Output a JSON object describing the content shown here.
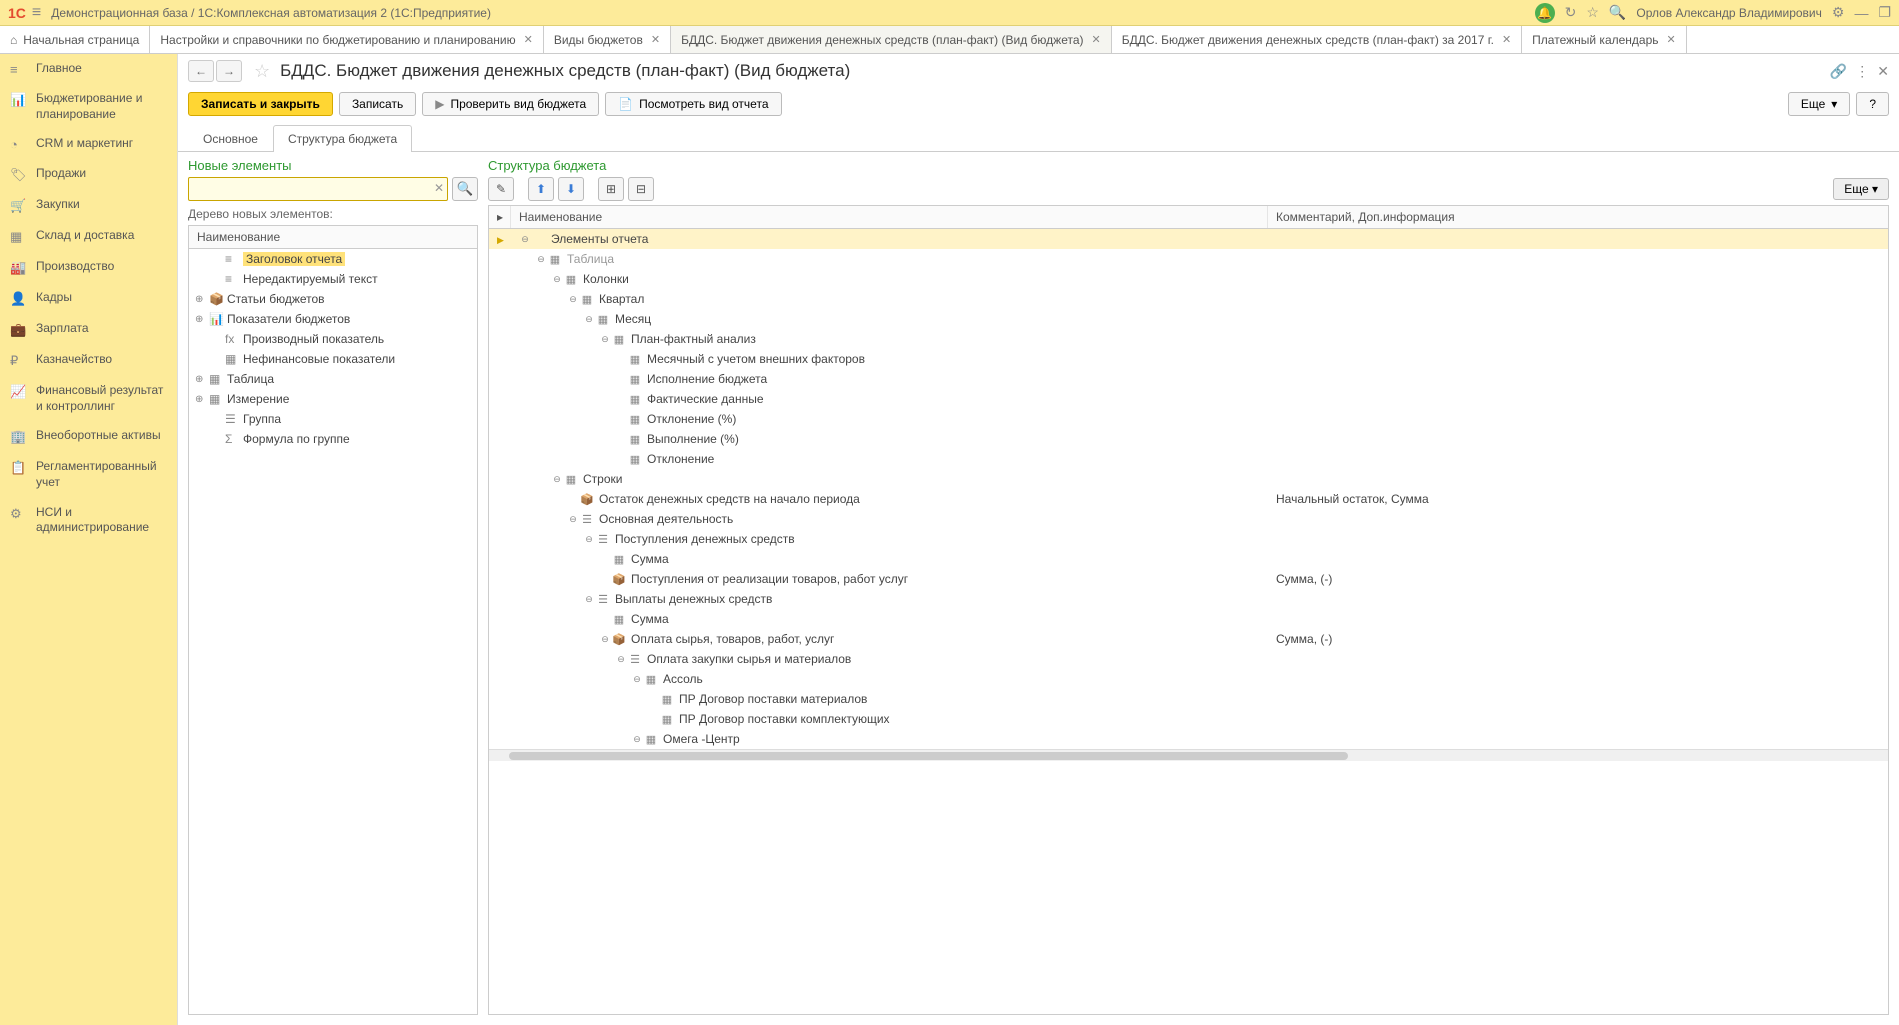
{
  "titlebar": {
    "logo": "1С",
    "title": "Демонстрационная база / 1С:Комплексная автоматизация 2 (1С:Предприятие)",
    "user": "Орлов Александр Владимирович"
  },
  "tabs": [
    {
      "label": "Начальная страница",
      "home": true
    },
    {
      "label": "Настройки и справочники по бюджетированию и планированию",
      "close": true
    },
    {
      "label": "Виды бюджетов",
      "close": true
    },
    {
      "label": "БДДС. Бюджет движения денежных средств (план-факт) (Вид бюджета)",
      "close": true,
      "active": true
    },
    {
      "label": "БДДС. Бюджет движения денежных средств (план-факт) за 2017 г.",
      "close": true
    },
    {
      "label": "Платежный календарь",
      "close": true
    }
  ],
  "sidebar": [
    {
      "icon": "≡",
      "label": "Главное"
    },
    {
      "icon": "📊",
      "label": "Бюджетирование и планирование"
    },
    {
      "icon": "◔",
      "label": "CRM и маркетинг"
    },
    {
      "icon": "🏷",
      "label": "Продажи"
    },
    {
      "icon": "🛒",
      "label": "Закупки"
    },
    {
      "icon": "▦",
      "label": "Склад и доставка"
    },
    {
      "icon": "🏭",
      "label": "Производство"
    },
    {
      "icon": "👤",
      "label": "Кадры"
    },
    {
      "icon": "💼",
      "label": "Зарплата"
    },
    {
      "icon": "₽",
      "label": "Казначейство"
    },
    {
      "icon": "📈",
      "label": "Финансовый результат и контроллинг"
    },
    {
      "icon": "🏢",
      "label": "Внеоборотные активы"
    },
    {
      "icon": "📋",
      "label": "Регламентированный учет"
    },
    {
      "icon": "⚙",
      "label": "НСИ и администрирование"
    }
  ],
  "page": {
    "title": "БДДС. Бюджет движения денежных средств (план-факт) (Вид бюджета)",
    "btn_save_close": "Записать и закрыть",
    "btn_save": "Записать",
    "btn_check": "Проверить вид бюджета",
    "btn_view": "Посмотреть вид отчета",
    "btn_more": "Еще",
    "btn_help": "?"
  },
  "innertabs": [
    {
      "label": "Основное"
    },
    {
      "label": "Структура бюджета",
      "active": true
    }
  ],
  "left": {
    "title": "Новые элементы",
    "tree_label": "Дерево новых элементов:",
    "col_name": "Наименование",
    "rows": [
      {
        "indent": 1,
        "exp": "",
        "icon": "≡",
        "label": "Заголовок отчета",
        "selected": true
      },
      {
        "indent": 1,
        "exp": "",
        "icon": "≡",
        "label": "Нередактируемый текст"
      },
      {
        "indent": 0,
        "exp": "⊕",
        "icon": "📦",
        "iconClass": "ic-grp",
        "label": "Статьи бюджетов"
      },
      {
        "indent": 0,
        "exp": "⊕",
        "icon": "📊",
        "iconClass": "ic-grp",
        "label": "Показатели бюджетов"
      },
      {
        "indent": 1,
        "exp": "",
        "icon": "fx",
        "iconClass": "ic-fx",
        "label": "Производный показатель"
      },
      {
        "indent": 1,
        "exp": "",
        "icon": "▦",
        "label": "Нефинансовые показатели"
      },
      {
        "indent": 0,
        "exp": "⊕",
        "icon": "▦",
        "iconClass": "ic-tbl",
        "label": "Таблица"
      },
      {
        "indent": 0,
        "exp": "⊕",
        "icon": "▦",
        "iconClass": "ic-tbl",
        "label": "Измерение"
      },
      {
        "indent": 1,
        "exp": "",
        "icon": "☰",
        "label": "Группа"
      },
      {
        "indent": 1,
        "exp": "",
        "icon": "Σ",
        "label": "Формула по группе"
      }
    ]
  },
  "right": {
    "title": "Структура бюджета",
    "btn_more": "Еще",
    "col_name": "Наименование",
    "col_comment": "Комментарий, Доп.информация",
    "rows": [
      {
        "indent": 0,
        "exp": "⊖",
        "icon": "",
        "label": "Элементы отчета",
        "selected": true,
        "comment": ""
      },
      {
        "indent": 1,
        "exp": "⊖",
        "icon": "▦",
        "iconClass": "ic-tbl",
        "label": "Таблица",
        "comment": "",
        "muted": true
      },
      {
        "indent": 2,
        "exp": "⊖",
        "icon": "▦",
        "iconClass": "ic-green",
        "label": "Колонки",
        "comment": ""
      },
      {
        "indent": 3,
        "exp": "⊖",
        "icon": "▦",
        "iconClass": "ic-tbl",
        "label": "Квартал",
        "comment": ""
      },
      {
        "indent": 4,
        "exp": "⊖",
        "icon": "▦",
        "iconClass": "ic-tbl",
        "label": "Месяц",
        "comment": ""
      },
      {
        "indent": 5,
        "exp": "⊖",
        "icon": "▦",
        "iconClass": "ic-tbl",
        "label": "План-фактный анализ",
        "comment": ""
      },
      {
        "indent": 6,
        "exp": "",
        "icon": "▦",
        "iconClass": "ic-tbl",
        "label": "Месячный с учетом внешних факторов",
        "comment": ""
      },
      {
        "indent": 6,
        "exp": "",
        "icon": "▦",
        "iconClass": "ic-tbl",
        "label": "Исполнение бюджета",
        "comment": ""
      },
      {
        "indent": 6,
        "exp": "",
        "icon": "▦",
        "iconClass": "ic-tbl",
        "label": "Фактические данные",
        "comment": ""
      },
      {
        "indent": 6,
        "exp": "",
        "icon": "▦",
        "iconClass": "ic-tbl",
        "label": "Отклонение (%)",
        "comment": ""
      },
      {
        "indent": 6,
        "exp": "",
        "icon": "▦",
        "iconClass": "ic-tbl",
        "label": "Выполнение (%)",
        "comment": ""
      },
      {
        "indent": 6,
        "exp": "",
        "icon": "▦",
        "iconClass": "ic-tbl",
        "label": "Отклонение",
        "comment": ""
      },
      {
        "indent": 2,
        "exp": "⊖",
        "icon": "▦",
        "iconClass": "ic-grp",
        "label": "Строки",
        "comment": ""
      },
      {
        "indent": 3,
        "exp": "",
        "icon": "📦",
        "iconClass": "ic-grp",
        "label": "Остаток денежных средств на начало периода",
        "comment": "Начальный остаток, Сумма"
      },
      {
        "indent": 3,
        "exp": "⊖",
        "icon": "☰",
        "label": "Основная деятельность",
        "comment": ""
      },
      {
        "indent": 4,
        "exp": "⊖",
        "icon": "☰",
        "label": "Поступления денежных средств",
        "comment": ""
      },
      {
        "indent": 5,
        "exp": "",
        "icon": "▦",
        "iconClass": "ic-tbl",
        "label": "Сумма",
        "comment": ""
      },
      {
        "indent": 5,
        "exp": "",
        "icon": "📦",
        "iconClass": "ic-grp",
        "label": "Поступления от реализации товаров, работ услуг",
        "comment": "Сумма, (-)"
      },
      {
        "indent": 4,
        "exp": "⊖",
        "icon": "☰",
        "label": "Выплаты денежных средств",
        "comment": ""
      },
      {
        "indent": 5,
        "exp": "",
        "icon": "▦",
        "iconClass": "ic-tbl",
        "label": "Сумма",
        "comment": ""
      },
      {
        "indent": 5,
        "exp": "⊖",
        "icon": "📦",
        "iconClass": "ic-grp",
        "label": "Оплата сырья, товаров, работ, услуг",
        "comment": "Сумма, (-)"
      },
      {
        "indent": 6,
        "exp": "⊖",
        "icon": "☰",
        "label": "Оплата закупки сырья и материалов",
        "comment": ""
      },
      {
        "indent": 7,
        "exp": "⊖",
        "icon": "▦",
        "iconClass": "ic-tbl",
        "label": "Ассоль",
        "comment": ""
      },
      {
        "indent": 8,
        "exp": "",
        "icon": "▦",
        "iconClass": "ic-tbl",
        "label": "ПР Договор поставки материалов",
        "comment": ""
      },
      {
        "indent": 8,
        "exp": "",
        "icon": "▦",
        "iconClass": "ic-tbl",
        "label": "ПР Договор поставки комплектующих",
        "comment": ""
      },
      {
        "indent": 7,
        "exp": "⊖",
        "icon": "▦",
        "iconClass": "ic-tbl",
        "label": "Омега -Центр",
        "comment": ""
      }
    ]
  }
}
